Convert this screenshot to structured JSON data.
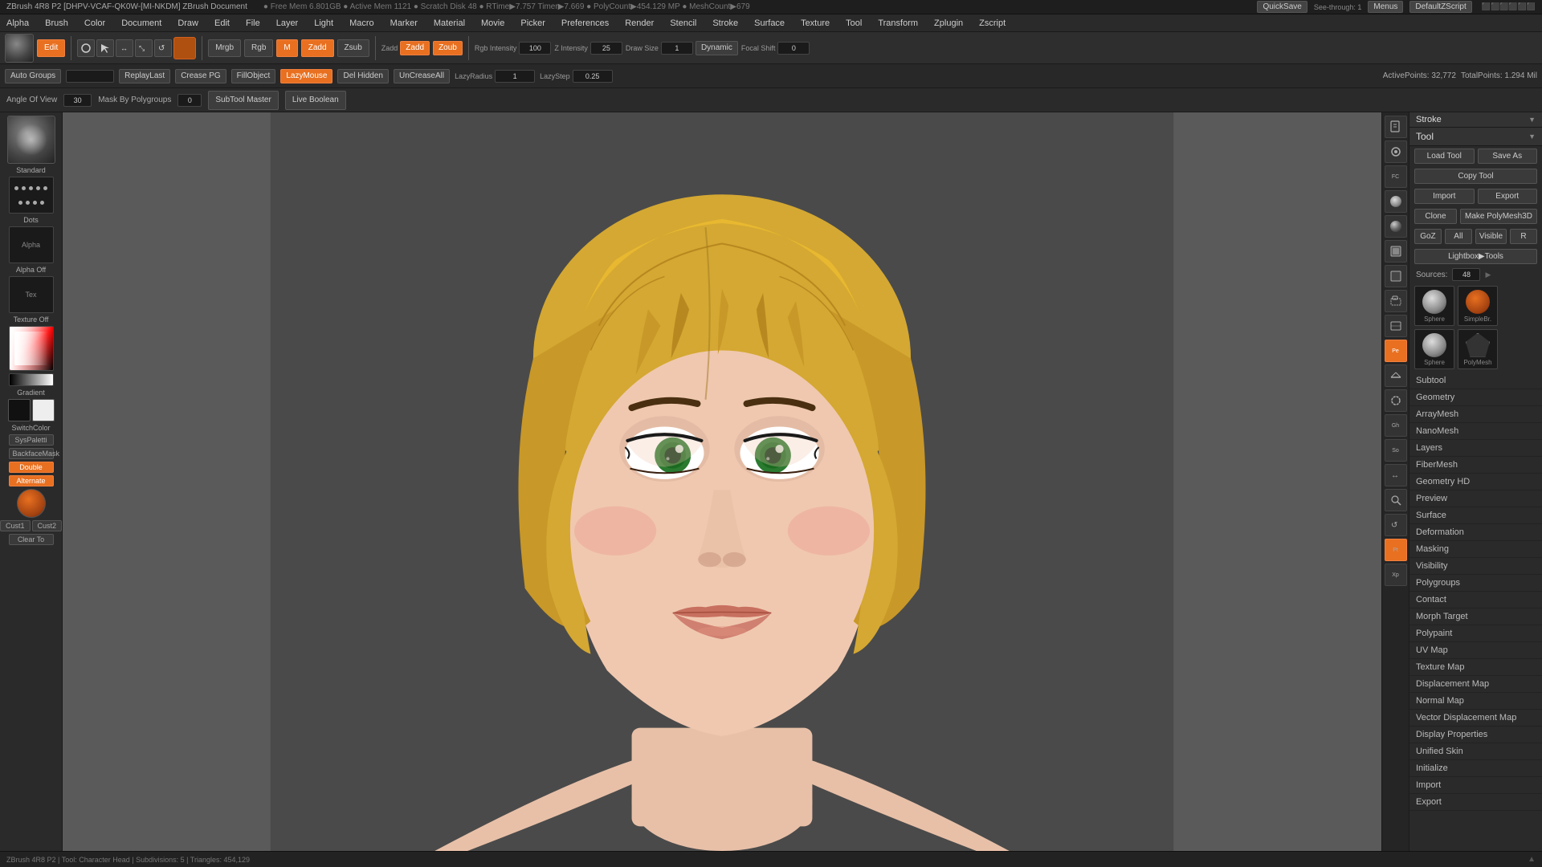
{
  "app": {
    "title": "ZBrush 4R8 P2 [DHPV-VCAF-QK0W-[MI-NKDM]  ZBrush Document",
    "version": "ZBrush 4R8 P2"
  },
  "titlebar": {
    "info": "● Free Mem 6.801GB ● Active Mem 1121 ● Scratch Disk 48 ● RTime▶7.757 Timer▶7.669 ● PolyCount▶454.129 MP ● MeshCount▶679"
  },
  "quicksave": {
    "label": "QuickSave",
    "seethrough_label": "See-through: 1",
    "menus_label": "Menus",
    "defaultzscript_label": "DefaultZScript"
  },
  "topmenu": {
    "items": [
      "Alpha",
      "Brush",
      "Color",
      "Document",
      "Draw",
      "Edit",
      "File",
      "Layer",
      "Light",
      "Macro",
      "Marker",
      "Material",
      "Movie",
      "Picker",
      "Preferences",
      "Render",
      "Stencil",
      "Stroke",
      "Surface",
      "Texture",
      "Tool",
      "Transform",
      "Zplugin",
      "Zscript"
    ]
  },
  "toolbar": {
    "edit_btn": "Edit",
    "draw_btn": "Draw",
    "move_btn": "Move",
    "scale_btn": "Scale",
    "rotate_btn": "Rotate",
    "mrgb_label": "Mrgb",
    "rgb_label": "Rgb",
    "m_label": "M",
    "zadd_label": "Zadd",
    "zsub_label": "Zsub",
    "rgb_intensity_label": "Rgb Intensity",
    "rgb_intensity_val": "100",
    "z_intensity_label": "Z Intensity",
    "z_intensity_val": "25",
    "draw_size_label": "Draw Size",
    "draw_size_val": "1",
    "dynamic_label": "Dynamic",
    "focal_shift_label": "Focal Shift",
    "focal_shift_val": "0",
    "live_boolean": "Live Boolean"
  },
  "toolbar2": {
    "bust_groups": "Auto Groups",
    "replay_last": "ReplayLast",
    "crease_pg": "Crease PG",
    "fill_object": "FillObject",
    "lazy_mouse": "LazyMouse",
    "del_hidden": "Del Hidden",
    "un_crease_all": "UnCreaseAll",
    "lazy_radius": "LazyRadius",
    "lazy_radius_val": "1",
    "lazy_step": "LazyStep",
    "lazy_step_val": "0.25",
    "active_points": "ActivePoints: 32,772",
    "total_points": "TotalPoints: 1.294 Mil"
  },
  "subtool": {
    "angle_of_view": "Angle Of View",
    "angle_val": "30",
    "mask_by": "Mask By Polygroups",
    "mask_val": "0",
    "subtool_master": "SubTool\nMaster"
  },
  "left_panel": {
    "standard_label": "Standard",
    "dots_label": "Dots",
    "alpha_off": "Alpha Off",
    "texture_off": "Texture Off",
    "gradient_label": "Gradient",
    "sys_palette": "SysPaletti",
    "backface_mask": "BackfaceMask",
    "double_label": "Double",
    "cust1": "Cust1",
    "cust2": "Cust2",
    "clear_to": "Clear To",
    "alt_label": "Alternate",
    "switch_color": "SwitchColor"
  },
  "stroke_panel": {
    "title": "Stroke"
  },
  "tool_panel": {
    "title": "Tool",
    "load_tool": "Load Tool",
    "save_as": "Save As",
    "copy_tool": "Copy Tool",
    "import_btn": "Import",
    "export_btn": "Export",
    "clone_btn": "Clone",
    "make_polymesh3d": "Make PolyMesh3D",
    "goz_btn": "GoZ",
    "all_btn": "All",
    "visible_btn": "Visible",
    "r_btn": "R",
    "lightbox_tools": "Lightbox▶Tools",
    "sources_label": "Sources:",
    "sources_val": "48",
    "items": [
      "Subtool",
      "Geometry",
      "ArrayMesh",
      "NanoMesh",
      "Layers",
      "FiberMesh",
      "Geometry HD",
      "Preview",
      "Surface",
      "Deformation",
      "Masking",
      "Visibility",
      "Polygroups",
      "Contact",
      "Morph Target",
      "Polypaint",
      "UV Map",
      "Texture Map",
      "Displacement Map",
      "Normal Map",
      "Vector Displacement Map",
      "Display Properties",
      "Unified Skin",
      "Initialize",
      "Import",
      "Export"
    ],
    "tool_previews": [
      {
        "name": "Sphere",
        "type": "sphere"
      },
      {
        "name": "SimpleBrush",
        "type": "simple"
      },
      {
        "name": "Sphere_sm",
        "type": "sphere_sm"
      },
      {
        "name": "PolyMesh",
        "type": "poly"
      }
    ]
  },
  "canvas": {
    "bottom_hint": "▲"
  },
  "icon_strip": {
    "icons": [
      {
        "name": "new-icon",
        "label": "New"
      },
      {
        "name": "brush-settings-icon",
        "label": "BS"
      },
      {
        "name": "flat-color-icon",
        "label": "FC"
      },
      {
        "name": "skin-shading-icon",
        "label": "Sk"
      },
      {
        "name": "longhi-icon",
        "label": "Lo"
      },
      {
        "name": "masking-la-icon",
        "label": "Ml"
      },
      {
        "name": "masking-v-icon",
        "label": "Mv"
      },
      {
        "name": "select-a-icon",
        "label": "Sa"
      },
      {
        "name": "select-b-icon",
        "label": "Sb"
      },
      {
        "name": "persp-icon",
        "label": "Pe",
        "active": true
      },
      {
        "name": "floor-icon",
        "label": "Fl"
      },
      {
        "name": "transp-icon",
        "label": "Tr"
      },
      {
        "name": "ghost-icon",
        "label": "Gh"
      },
      {
        "name": "solo-icon",
        "label": "So"
      },
      {
        "name": "move-icon",
        "label": "Mo"
      },
      {
        "name": "zoom-to-icon",
        "label": "Zt"
      },
      {
        "name": "rotate-icon",
        "label": "Ro"
      },
      {
        "name": "polyt-icon",
        "label": "Pt"
      },
      {
        "name": "xpose-icon",
        "label": "Xp"
      }
    ]
  }
}
